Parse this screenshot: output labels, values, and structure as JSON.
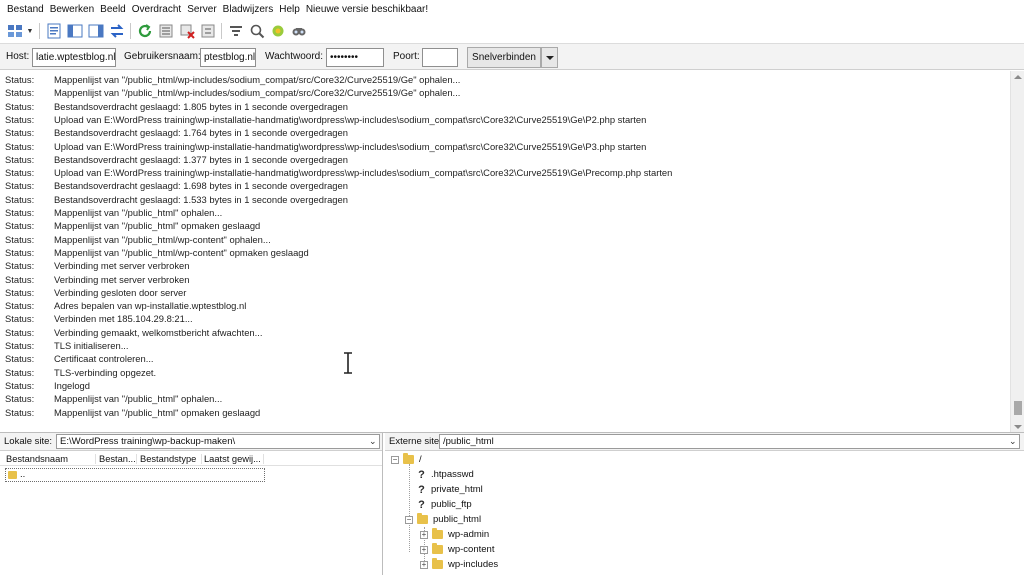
{
  "menu": [
    "Bestand",
    "Bewerken",
    "Beeld",
    "Overdracht",
    "Server",
    "Bladwijzers",
    "Help",
    "Nieuwe versie beschikbaar!"
  ],
  "quickconnect": {
    "host_label": "Host:",
    "host_value": "latie.wptestblog.nl",
    "user_label": "Gebruikersnaam:",
    "user_value": "ptestblog.nl",
    "pass_label": "Wachtwoord:",
    "pass_value": "••••••••",
    "port_label": "Poort:",
    "port_value": "",
    "connect_label": "Snelverbinden"
  },
  "log": [
    {
      "k": "Status:",
      "m": "Mappenlijst van \"/public_html/wp-includes/sodium_compat/src/Core32/Curve25519/Ge\" ophalen..."
    },
    {
      "k": "Status:",
      "m": "Mappenlijst van \"/public_html/wp-includes/sodium_compat/src/Core32/Curve25519/Ge\" ophalen..."
    },
    {
      "k": "Status:",
      "m": "Bestandsoverdracht geslaagd: 1.805 bytes in 1 seconde overgedragen"
    },
    {
      "k": "Status:",
      "m": "Upload van E:\\WordPress training\\wp-installatie-handmatig\\wordpress\\wp-includes\\sodium_compat\\src\\Core32\\Curve25519\\Ge\\P2.php starten"
    },
    {
      "k": "Status:",
      "m": "Bestandsoverdracht geslaagd: 1.764 bytes in 1 seconde overgedragen"
    },
    {
      "k": "Status:",
      "m": "Upload van E:\\WordPress training\\wp-installatie-handmatig\\wordpress\\wp-includes\\sodium_compat\\src\\Core32\\Curve25519\\Ge\\P3.php starten"
    },
    {
      "k": "Status:",
      "m": "Bestandsoverdracht geslaagd: 1.377 bytes in 1 seconde overgedragen"
    },
    {
      "k": "Status:",
      "m": "Upload van E:\\WordPress training\\wp-installatie-handmatig\\wordpress\\wp-includes\\sodium_compat\\src\\Core32\\Curve25519\\Ge\\Precomp.php starten"
    },
    {
      "k": "Status:",
      "m": "Bestandsoverdracht geslaagd: 1.698 bytes in 1 seconde overgedragen"
    },
    {
      "k": "Status:",
      "m": "Bestandsoverdracht geslaagd: 1.533 bytes in 1 seconde overgedragen"
    },
    {
      "k": "Status:",
      "m": "Mappenlijst van \"/public_html\" ophalen..."
    },
    {
      "k": "Status:",
      "m": "Mappenlijst van \"/public_html\" opmaken geslaagd"
    },
    {
      "k": "Status:",
      "m": "Mappenlijst van \"/public_html/wp-content\" ophalen..."
    },
    {
      "k": "Status:",
      "m": "Mappenlijst van \"/public_html/wp-content\" opmaken geslaagd"
    },
    {
      "k": "Status:",
      "m": "Verbinding met server verbroken"
    },
    {
      "k": "Status:",
      "m": "Verbinding met server verbroken"
    },
    {
      "k": "Status:",
      "m": "Verbinding gesloten door server"
    },
    {
      "k": "Status:",
      "m": "Adres bepalen van wp-installatie.wptestblog.nl"
    },
    {
      "k": "Status:",
      "m": "Verbinden met 185.104.29.8:21..."
    },
    {
      "k": "Status:",
      "m": "Verbinding gemaakt, welkomstbericht afwachten..."
    },
    {
      "k": "Status:",
      "m": "TLS initialiseren..."
    },
    {
      "k": "Status:",
      "m": "Certificaat controleren..."
    },
    {
      "k": "Status:",
      "m": "TLS-verbinding opgezet."
    },
    {
      "k": "Status:",
      "m": "Ingelogd"
    },
    {
      "k": "Status:",
      "m": "Mappenlijst van \"/public_html\" ophalen..."
    },
    {
      "k": "Status:",
      "m": "Mappenlijst van \"/public_html\" opmaken geslaagd"
    }
  ],
  "local": {
    "label": "Lokale site:",
    "path": "E:\\WordPress training\\wp-backup-maken\\",
    "columns": [
      "Bestandsnaam",
      "Bestan...",
      "Bestandstype",
      "Laatst gewij..."
    ],
    "rows": [
      ".."
    ]
  },
  "remote": {
    "label": "Externe site:",
    "path": "/public_html",
    "root": "/",
    "unknown_mark": "?",
    "items": [
      ".htpasswd",
      "private_html",
      "public_ftp",
      "public_html",
      "wp-admin",
      "wp-content",
      "wp-includes"
    ]
  }
}
